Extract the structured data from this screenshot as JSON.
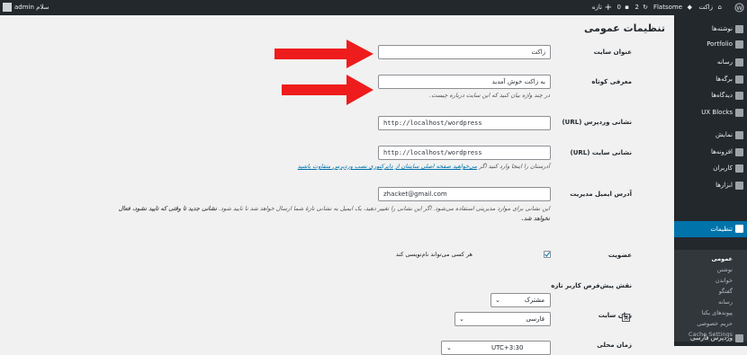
{
  "admin_bar": {
    "site_name": "زاکت",
    "theme": "Flatsome",
    "updates": "2",
    "comments": "0",
    "new_label": "تازه",
    "greeting": "سلام",
    "user": "admin"
  },
  "sidebar": {
    "items": [
      {
        "label": "نوشته‌ها",
        "icon": "pin-icon"
      },
      {
        "label": "Portfolio",
        "icon": "portfolio-icon"
      },
      {
        "label": "رسانه",
        "icon": "media-icon"
      },
      {
        "label": "برگه‌ها",
        "icon": "page-icon"
      },
      {
        "label": "دیدگاه‌ها",
        "icon": "comments-icon"
      },
      {
        "label": "UX Blocks",
        "icon": "blocks-icon"
      },
      {
        "label": "نمایش",
        "icon": "appearance-icon"
      },
      {
        "label": "افزونه‌ها",
        "icon": "plugins-icon"
      },
      {
        "label": "کاربران",
        "icon": "users-icon"
      },
      {
        "label": "ابزارها",
        "icon": "tools-icon"
      },
      {
        "label": "تنظیمات",
        "icon": "settings-icon"
      }
    ],
    "submenu": [
      "عمومی",
      "نوشتن",
      "خواندن",
      "گفتگو",
      "رسانه",
      "پیوندهای یکتا",
      "حریم خصوصی",
      "Cache Settings"
    ],
    "footer": {
      "label": "وردپرس فارسی",
      "icon": "wp-persian-icon"
    }
  },
  "page": {
    "title": "تنظیمات عمومی",
    "fields": {
      "site_title": {
        "label": "عنوان سایت",
        "value": "زاکت"
      },
      "tagline": {
        "label": "معرفی کوتاه",
        "value": "به زاکت خوش آمدید",
        "description": "در چند واژه بیان کنید که این سایت درباره چیست."
      },
      "wp_address": {
        "label": "نشانی وردپرس (URL)",
        "value": "http://localhost/wordpress"
      },
      "site_address": {
        "label": "نشانی سایت (URL)",
        "value": "http://localhost/wordpress",
        "description_prefix": "آدرستان را اینجا وارد کنید اگر ",
        "description_link": "می‌خواهید صفحه اصلی سایتتان از دایرکتوری نصب وردپرس متفاوت باشید"
      },
      "admin_email": {
        "label": "آدرس ایمیل مدیریت",
        "value": "zhacket@gmail.com",
        "description_line1": "این نشانی برای موارد مدیریتی استفاده می‌شود. اگر این نشانی را تغییر دهید، یک ایمیل به نشانی تازهٔ شما ارسال خواهد شد تا تایید شود.",
        "description_bold": "نشانی جدید تا وقتی که تایید نشود، فعال",
        "description_line2": "نخواهد شد."
      },
      "membership": {
        "label": "عضویت",
        "checkbox_label": "هر کسی می‌تواند نام‌نویسی کند",
        "checked": true
      },
      "default_role": {
        "label": "نقش پیش‌فرض کاربر تازه",
        "value": "مشترک"
      },
      "site_language": {
        "label": "زبان سایت",
        "value": "فارسی",
        "icon": "translate-icon"
      },
      "timezone": {
        "label": "زمان محلی",
        "value": "UTC+3:30"
      }
    }
  },
  "annotations": {
    "arrow_color": "#ee1c1c"
  },
  "colors": {
    "admin_dark": "#23282d",
    "accent": "#0073aa",
    "background": "#f1f1f1"
  }
}
